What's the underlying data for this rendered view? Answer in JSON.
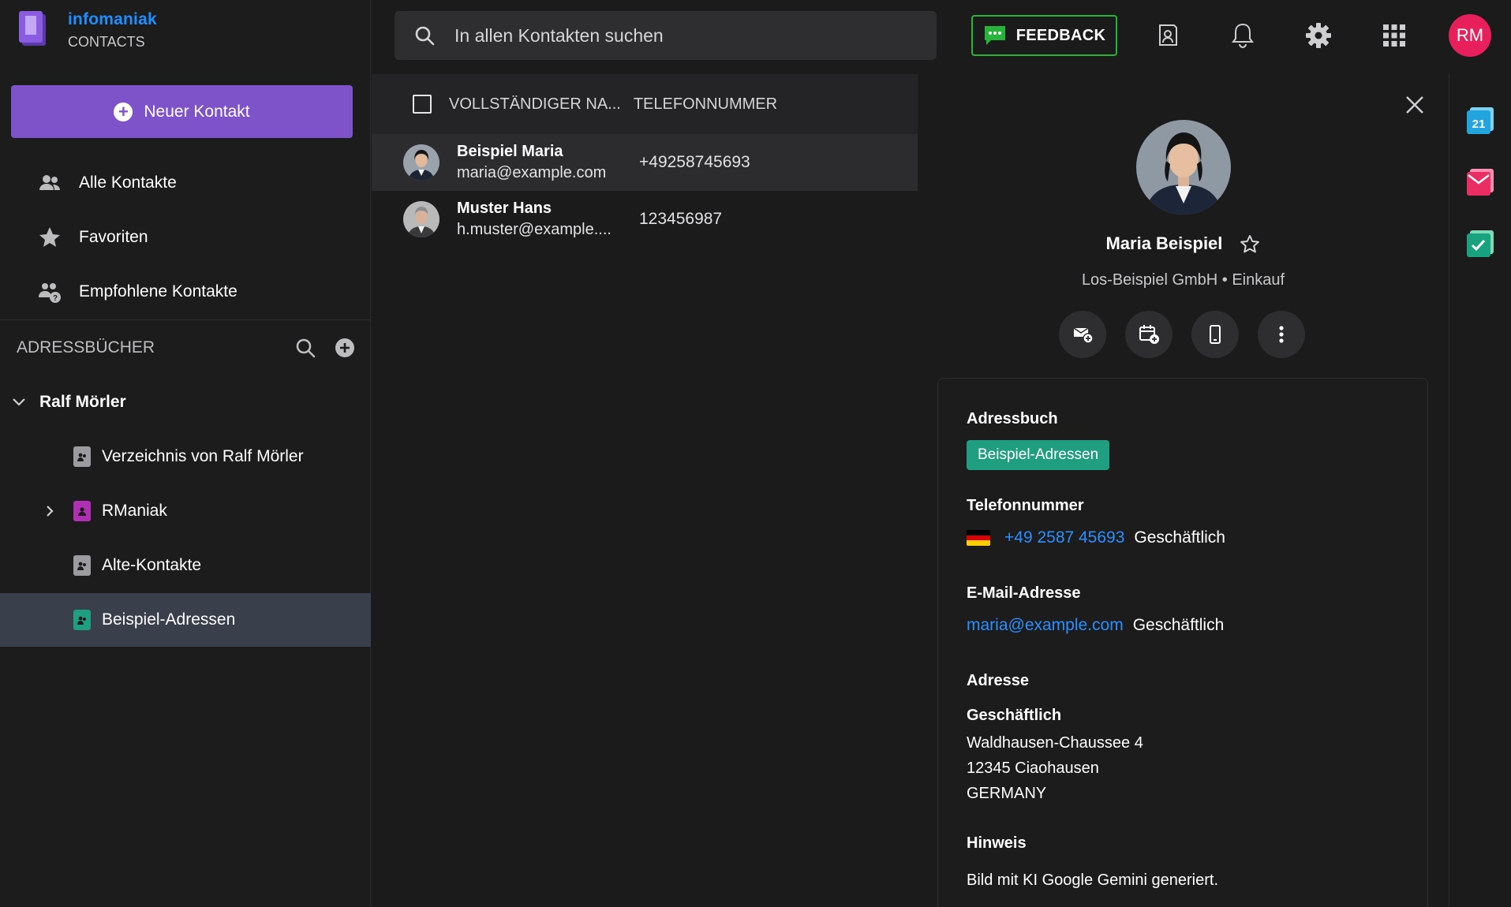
{
  "brand": {
    "name": "infomaniak",
    "product": "CONTACTS"
  },
  "sidebar": {
    "new_contact_label": "Neuer Kontakt",
    "nav": [
      {
        "label": "Alle Kontakte",
        "icon": "people-icon"
      },
      {
        "label": "Favoriten",
        "icon": "star-icon"
      },
      {
        "label": "Empfohlene Kontakte",
        "icon": "suggested-people-icon"
      }
    ],
    "addressbooks_title": "ADRESSBÜCHER",
    "owner": "Ralf Mörler",
    "books": [
      {
        "label": "Verzeichnis von Ralf Mörler",
        "color": "#9c9ca0"
      },
      {
        "label": "RManiak",
        "color": "#b02fb2"
      },
      {
        "label": "Alte-Kontakte",
        "color": "#9c9ca0"
      },
      {
        "label": "Beispiel-Adressen",
        "color": "#1f9e80"
      }
    ]
  },
  "topbar": {
    "search_placeholder": "In allen Kontakten suchen",
    "feedback_label": "FEEDBACK",
    "avatar_initials": "RM"
  },
  "list": {
    "col_name": "VOLLSTÄNDIGER NA...",
    "col_phone": "TELEFONNUMMER",
    "rows": [
      {
        "name": "Beispiel Maria",
        "email": "maria@example.com",
        "phone": "+49258745693"
      },
      {
        "name": "Muster Hans",
        "email": "h.muster@example....",
        "phone": "123456987"
      }
    ]
  },
  "detail": {
    "name": "Maria Beispiel",
    "org": "Los-Beispiel GmbH • Einkauf",
    "addressbook_label": "Adressbuch",
    "addressbook_value": "Beispiel-Adressen",
    "phone_label": "Telefonnummer",
    "phone_value": "+49 2587 45693",
    "phone_type": "Geschäftlich",
    "email_label": "E-Mail-Adresse",
    "email_value": "maria@example.com",
    "email_type": "Geschäftlich",
    "address_label": "Adresse",
    "address_type": "Geschäftlich",
    "address_street": "Waldhausen-Chaussee 4",
    "address_city": "12345 Ciaohausen",
    "address_country": "GERMANY",
    "note_label": "Hinweis",
    "note_value": "Bild mit KI Google Gemini generiert."
  },
  "colors": {
    "accent": "#7e52c9",
    "link": "#2b8fff",
    "chip": "#1f9e80",
    "feedback_border": "#28b33a",
    "avatar": "#e7205b"
  }
}
